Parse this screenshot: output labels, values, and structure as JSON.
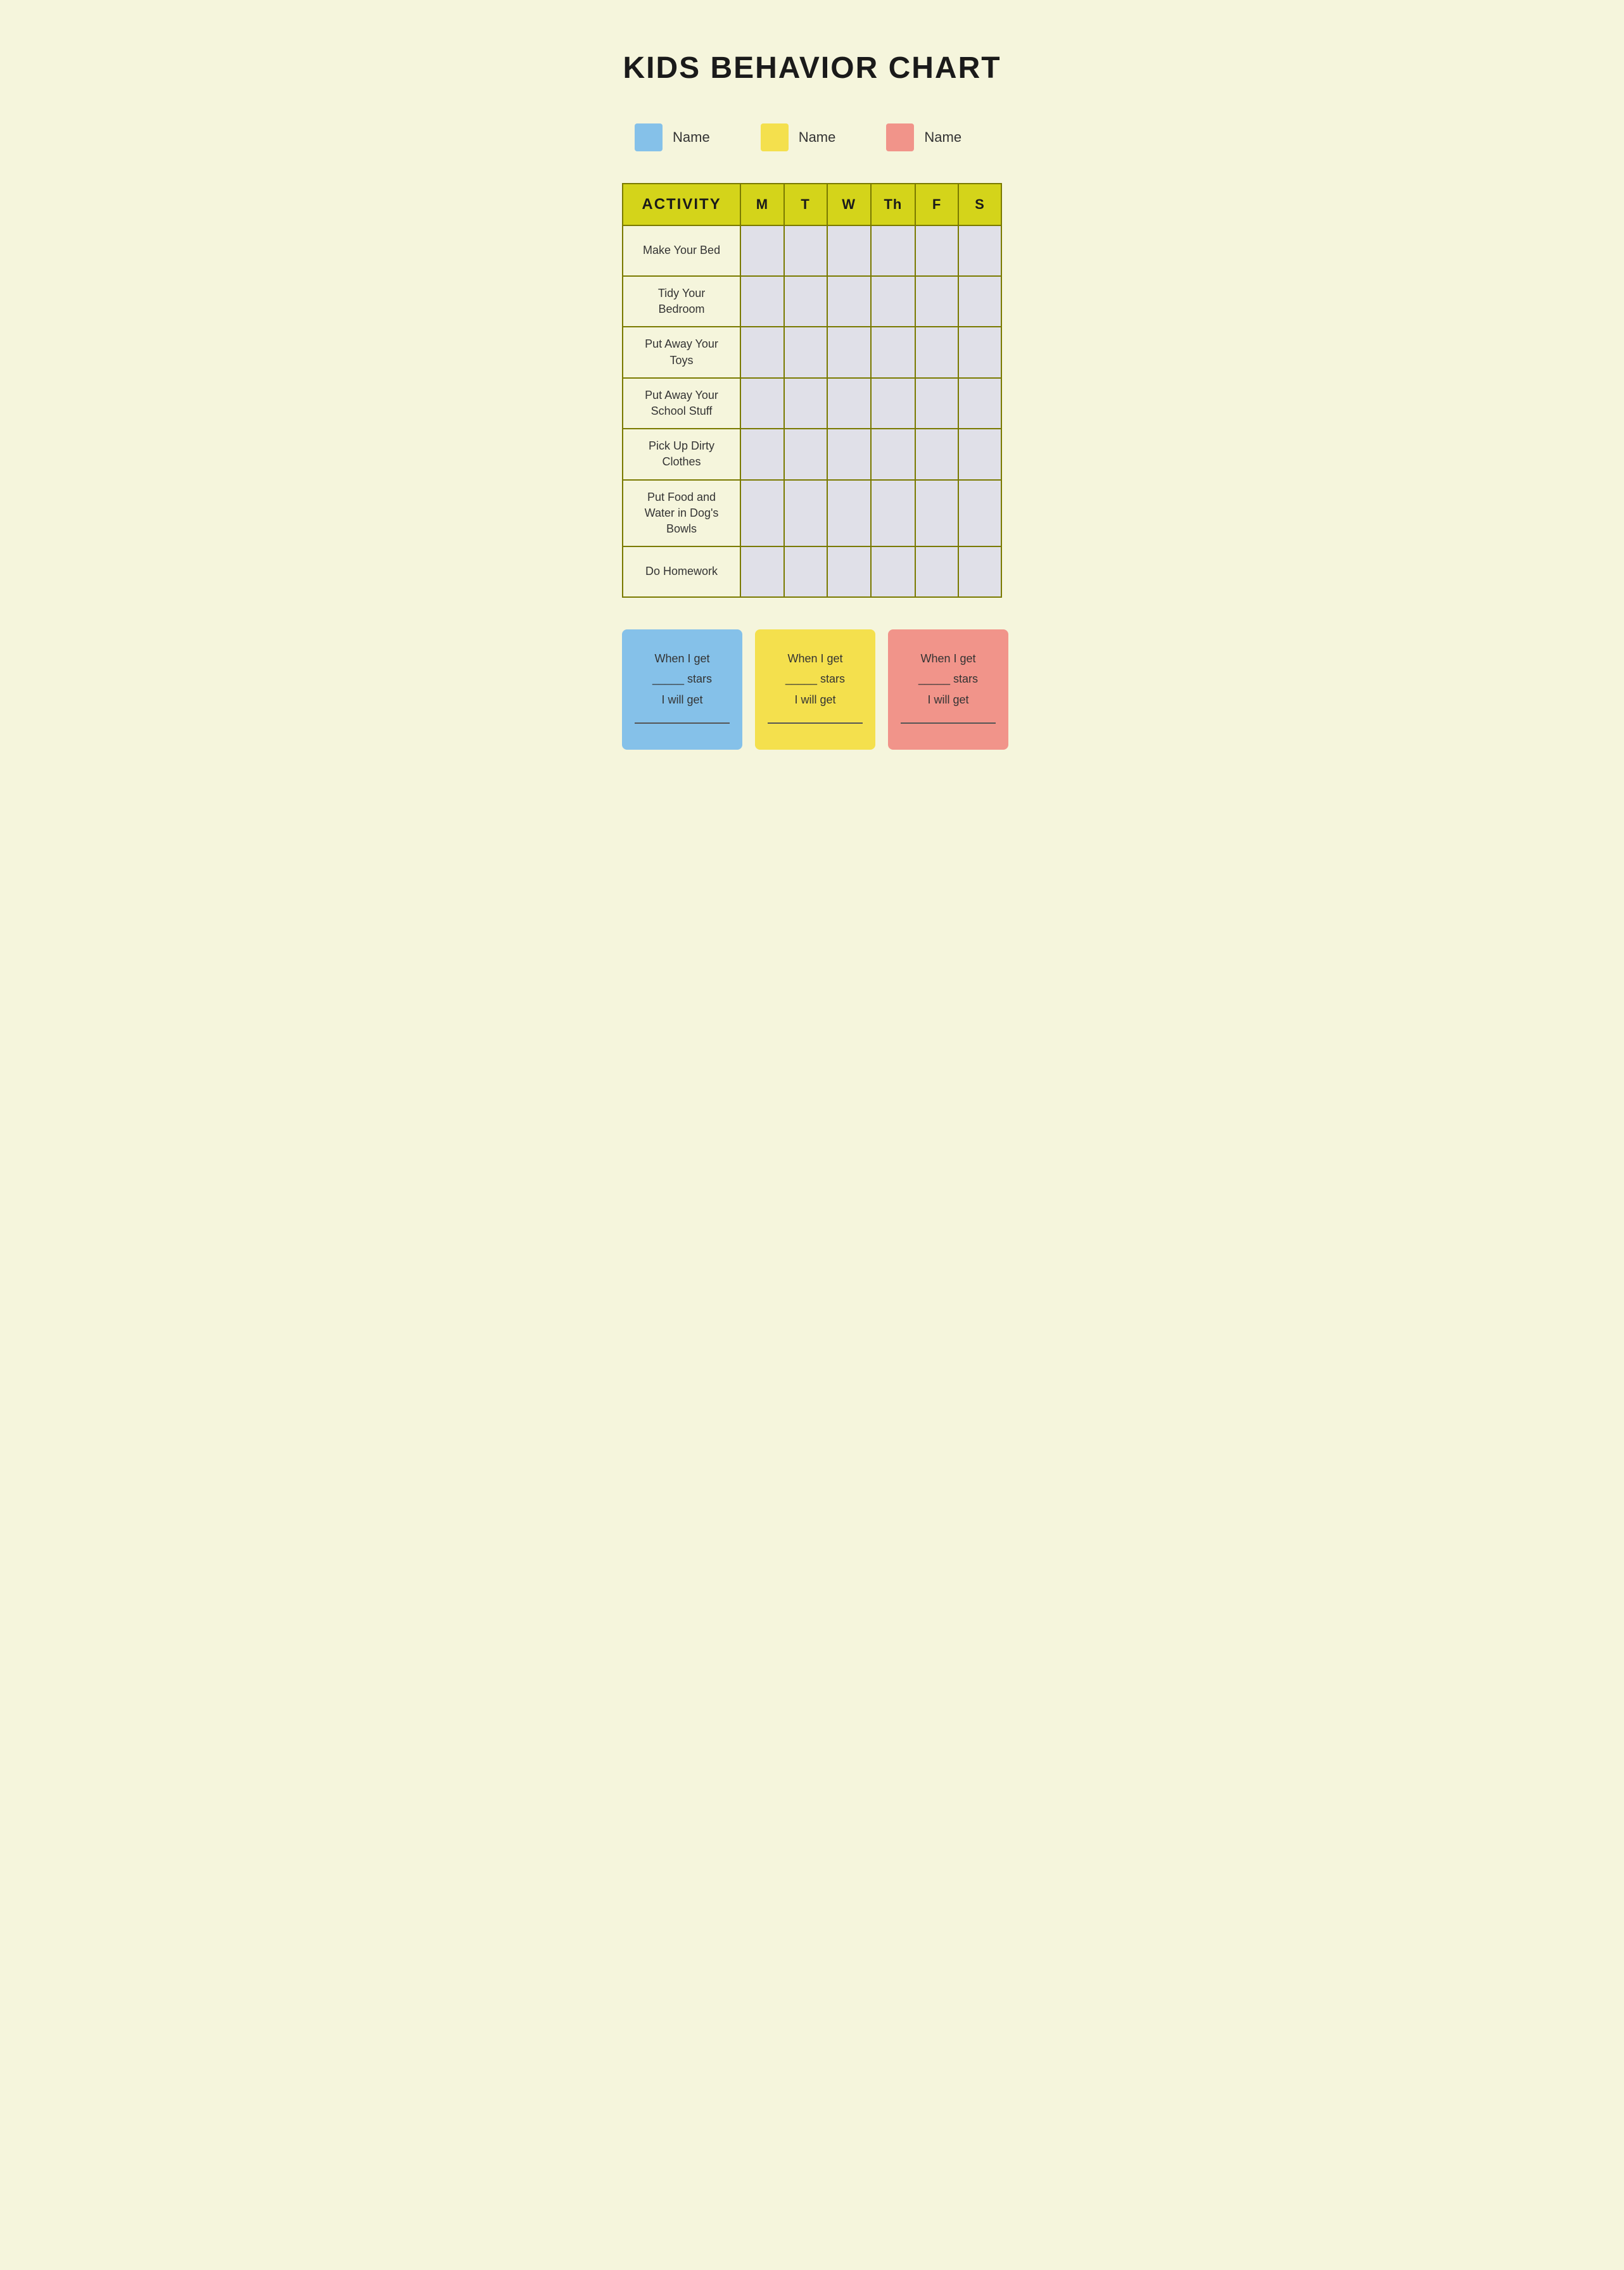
{
  "page": {
    "title": "KIDS BEHAVIOR CHART",
    "background_color": "#f0f0d8"
  },
  "legend": {
    "items": [
      {
        "label": "Name",
        "color": "#85c1e9"
      },
      {
        "label": "Name",
        "color": "#f4e04d"
      },
      {
        "label": "Name",
        "color": "#f1948a"
      }
    ]
  },
  "table": {
    "header": {
      "activity": "ACTIVITY",
      "days": [
        "M",
        "T",
        "W",
        "Th",
        "F",
        "S"
      ]
    },
    "rows": [
      {
        "activity": "Make Your Bed"
      },
      {
        "activity": "Tidy Your Bedroom"
      },
      {
        "activity": "Put Away Your Toys"
      },
      {
        "activity": "Put Away Your School Stuff"
      },
      {
        "activity": "Pick Up Dirty Clothes"
      },
      {
        "activity": "Put Food and Water in Dog's Bowls"
      },
      {
        "activity": "Do Homework"
      }
    ]
  },
  "reward_boxes": [
    {
      "color": "#85c1e9",
      "text_line1": "When I get",
      "text_line2": "_____ stars",
      "text_line3": "I will get"
    },
    {
      "color": "#f4e04d",
      "text_line1": "When I get",
      "text_line2": "_____ stars",
      "text_line3": "I will get"
    },
    {
      "color": "#f1948a",
      "text_line1": "When I get",
      "text_line2": "_____ stars",
      "text_line3": "I will get"
    }
  ]
}
